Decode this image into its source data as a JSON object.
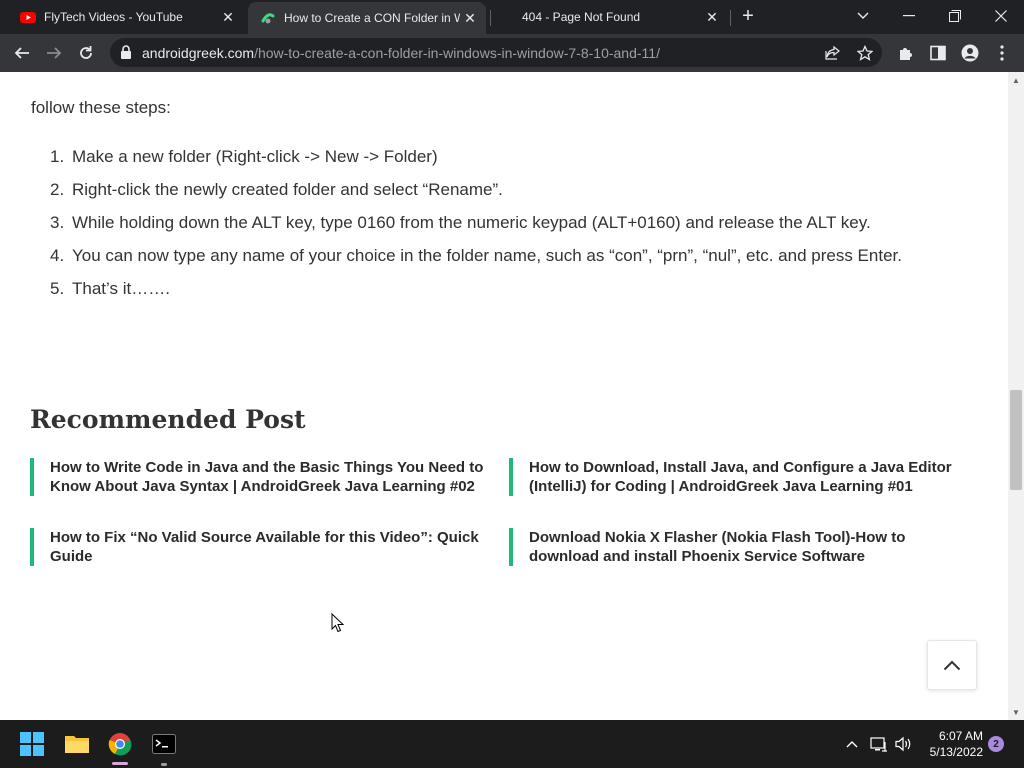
{
  "tabs": [
    {
      "title": "FlyTech Videos - YouTube",
      "favicon": "youtube-icon",
      "active": false
    },
    {
      "title": "How to Create a CON Folder in W",
      "favicon": "androidgreek-icon",
      "active": true
    },
    {
      "title": "404 - Page Not Found",
      "favicon": "",
      "active": false
    }
  ],
  "toolbar": {
    "url_host": "androidgreek.com",
    "url_path": "/how-to-create-a-con-folder-in-windows-in-window-7-8-10-and-11/"
  },
  "article": {
    "intro": "follow these steps:",
    "steps": [
      {
        "num": "1.",
        "text": "Make a new folder (Right-click -> New -> Folder)"
      },
      {
        "num": "2.",
        "text": "Right-click the newly created folder and select “Rename”."
      },
      {
        "num": "3.",
        "text": "While holding down the ALT key, type 0160 from the numeric keypad (ALT+0160) and release the ALT key."
      },
      {
        "num": "4.",
        "text": "You can now type any name of your choice in the folder name, such as “con”, “prn”, “nul”, etc. and press Enter."
      },
      {
        "num": "5.",
        "text": "That’s it……."
      }
    ]
  },
  "recommended": {
    "title": "Recommended Post",
    "posts": [
      "How to Write Code in Java and the Basic Things You Need to Know About Java Syntax | AndroidGreek Java Learning #02",
      "How to Download, Install Java, and Configure a Java Editor (IntelliJ) for Coding  | AndroidGreek Java Learning #01",
      "How to Fix “No Valid Source Available for this Video”: Quick Guide",
      "Download Nokia X Flasher (Nokia Flash Tool)-How to download and install Phoenix Service Software"
    ]
  },
  "taskbar": {
    "time": "6:07 AM",
    "date": "5/13/2022",
    "notifications": "2"
  },
  "colors": {
    "accent_green": "#1fb87a",
    "chrome_dark": "#202124",
    "chrome_toolbar": "#35363a"
  }
}
